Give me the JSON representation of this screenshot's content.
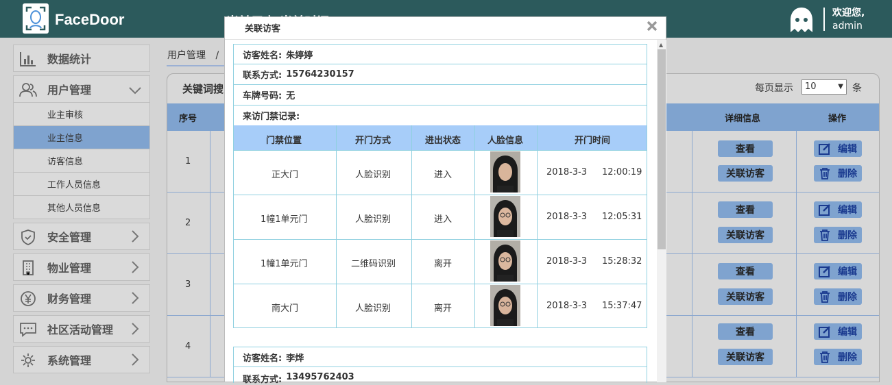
{
  "header": {
    "brand": "FaceDoor",
    "obscured_title": "当前用户  当前时间",
    "welcome": "欢迎您,",
    "username": "admin"
  },
  "sidebar": {
    "items": [
      {
        "label": "数据统计",
        "icon": "bar-chart-icon"
      },
      {
        "label": "用户管理",
        "icon": "users-icon",
        "expanded": true,
        "sub": [
          "业主审核",
          "业主信息",
          "访客信息",
          "工作人员信息",
          "其他人员信息"
        ],
        "active_sub": 1
      },
      {
        "label": "安全管理",
        "icon": "shield-icon"
      },
      {
        "label": "物业管理",
        "icon": "building-icon"
      },
      {
        "label": "财务管理",
        "icon": "yen-icon"
      },
      {
        "label": "社区活动管理",
        "icon": "chat-icon"
      },
      {
        "label": "系统管理",
        "icon": "gear-icon"
      }
    ]
  },
  "breadcrumb": {
    "first": "用户管理",
    "sep": "/"
  },
  "toolbar": {
    "keyword_label": "关键词搜",
    "per_page_label": "每页显示",
    "per_page_value": "10",
    "unit": "条"
  },
  "table": {
    "headers": {
      "index": "序号",
      "detail": "详细信息",
      "action": "操作"
    },
    "rows": [
      {
        "num": "1"
      },
      {
        "num": "2"
      },
      {
        "num": "3"
      },
      {
        "num": "4"
      }
    ],
    "view_label": "查看",
    "link_label": "关联访客",
    "edit_label": "编辑",
    "delete_label": "删除"
  },
  "modal": {
    "title": "关联访客",
    "visitor1": {
      "name_label": "访客姓名:",
      "name": "朱婷婷",
      "phone_label": "联系方式:",
      "phone": "15764230157",
      "plate_label": "车牌号码:",
      "plate": "无",
      "records_label": "来访门禁记录:"
    },
    "record_headers": [
      "门禁位置",
      "开门方式",
      "进出状态",
      "人脸信息",
      "开门时间"
    ],
    "records": [
      {
        "loc": "正大门",
        "method": "人脸识别",
        "status": "进入",
        "date": "2018-3-3",
        "time": "12:00:19"
      },
      {
        "loc": "1幢1单元门",
        "method": "人脸识别",
        "status": "进入",
        "date": "2018-3-3",
        "time": "12:05:31"
      },
      {
        "loc": "1幢1单元门",
        "method": "二维码识别",
        "status": "离开",
        "date": "2018-3-3",
        "time": "15:28:32"
      },
      {
        "loc": "南大门",
        "method": "人脸识别",
        "status": "离开",
        "date": "2018-3-3",
        "time": "15:37:47"
      }
    ],
    "visitor2": {
      "name_label": "访客姓名:",
      "name": "李烨",
      "phone_label": "联系方式:",
      "phone": "13495762403"
    }
  },
  "colors": {
    "header_bg": "#2c5a5c",
    "accent_blue": "#7fa3cf",
    "table_head": "#a7cdf9",
    "border_cyan": "#8fd0e0"
  }
}
